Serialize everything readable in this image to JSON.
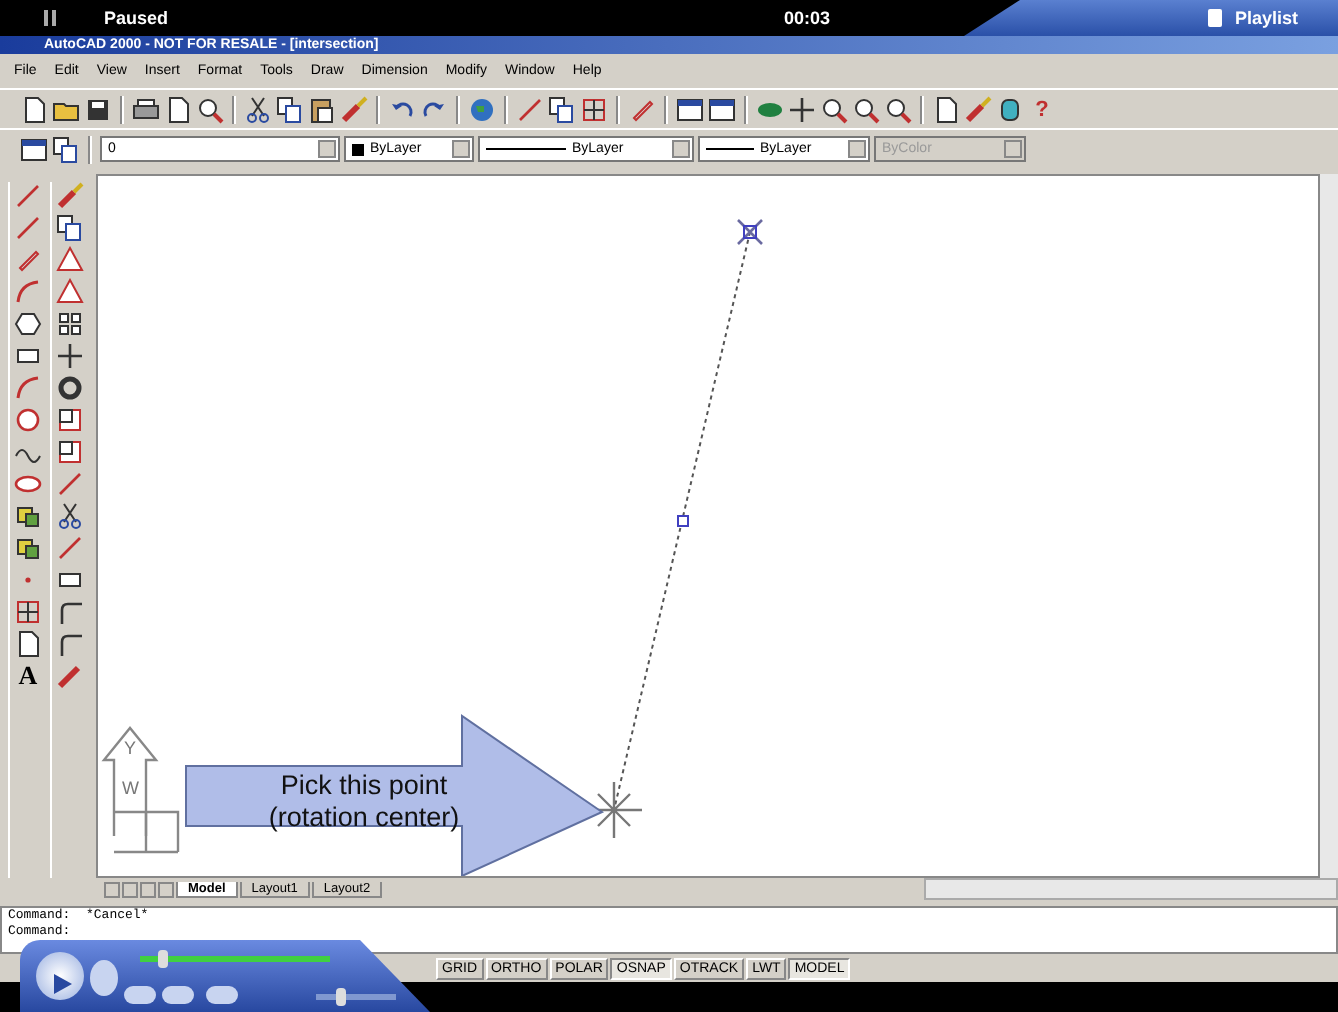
{
  "player": {
    "status": "Paused",
    "time": "00:03",
    "playlist": "Playlist",
    "seek": {
      "level": 0.12
    },
    "volume": {
      "level": 0.3
    }
  },
  "window": {
    "title": "AutoCAD 2000 - NOT FOR RESALE - [intersection]"
  },
  "menu": [
    "File",
    "Edit",
    "View",
    "Insert",
    "Format",
    "Tools",
    "Draw",
    "Dimension",
    "Modify",
    "Window",
    "Help"
  ],
  "standard_toolbar": {
    "help": "?"
  },
  "layer_toolbar": {
    "layer": "0",
    "color_setting": "ByLayer",
    "linetype": "ByLayer",
    "lineweight": "ByLayer",
    "plot_style": {
      "value": "ByColor",
      "disabled": true
    }
  },
  "draw_toolbar": {
    "text_tool": "A"
  },
  "ucs_icon": {
    "y_label": "Y",
    "w_label": "W"
  },
  "callout": {
    "text": "Pick this point\n(rotation center)"
  },
  "layout_tabs": [
    {
      "label": "Model",
      "selected": true
    },
    {
      "label": "Layout1",
      "selected": false
    },
    {
      "label": "Layout2",
      "selected": false
    }
  ],
  "command_lines": [
    "Command:  *Cancel*",
    "Command:"
  ],
  "status_buttons": [
    {
      "label": "GRID",
      "on": false
    },
    {
      "label": "ORTHO",
      "on": false
    },
    {
      "label": "POLAR",
      "on": false
    },
    {
      "label": "OSNAP",
      "on": true
    },
    {
      "label": "OTRACK",
      "on": false
    },
    {
      "label": "LWT",
      "on": false
    },
    {
      "label": "MODEL",
      "on": true
    }
  ]
}
